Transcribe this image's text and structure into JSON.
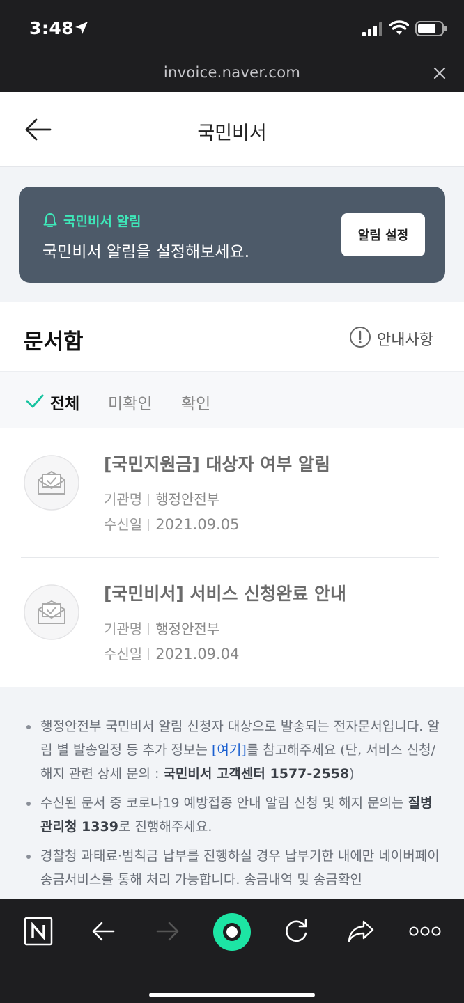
{
  "status": {
    "time": "3:48"
  },
  "url_bar": {
    "url": "invoice.naver.com"
  },
  "header": {
    "title": "국민비서"
  },
  "banner": {
    "label": "국민비서 알림",
    "message": "국민비서 알림을 설정해보세요.",
    "button": "알림 설정"
  },
  "docbox": {
    "title": "문서함",
    "notice": "안내사항",
    "tabs": [
      {
        "label": "전체",
        "active": true
      },
      {
        "label": "미확인",
        "active": false
      },
      {
        "label": "확인",
        "active": false
      }
    ],
    "items": [
      {
        "title": "[국민지원금] 대상자 여부 알림",
        "org_label": "기관명",
        "org": "행정안전부",
        "date_label": "수신일",
        "date": "2021.09.05"
      },
      {
        "title": "[국민비서] 서비스 신청완료 안내",
        "org_label": "기관명",
        "org": "행정안전부",
        "date_label": "수신일",
        "date": "2021.09.04"
      }
    ]
  },
  "notes": {
    "n1_a": "행정안전부 국민비서 알림 신청자 대상으로 발송되는 전자문서입니다. 알림 별 발송일정 등 추가 정보는 ",
    "n1_link": "[여기]",
    "n1_b": "를 참고해주세요 (단, 서비스 신청/해지 관련 상세 문의 : ",
    "n1_bold": "국민비서 고객센터 1577-2558",
    "n1_c": ")",
    "n2_a": "수신된 문서 중 코로나19 예방접종 안내 알림 신청 및 해지 문의는 ",
    "n2_bold": "질병관리청 1339",
    "n2_b": "로 진행해주세요.",
    "n3_a": "경찰청 과태료·범칙금 납부를 진행하실 경우 납부기한 내에만 네이버페이 송금서비스를 통해 처리 가능합니다. 송금내역 및 송금확인"
  },
  "colors": {
    "accent": "#3ee8b9",
    "banner_bg": "#4d5a69",
    "link": "#1a5fd0",
    "toolbar_bg": "#1e1e20"
  }
}
